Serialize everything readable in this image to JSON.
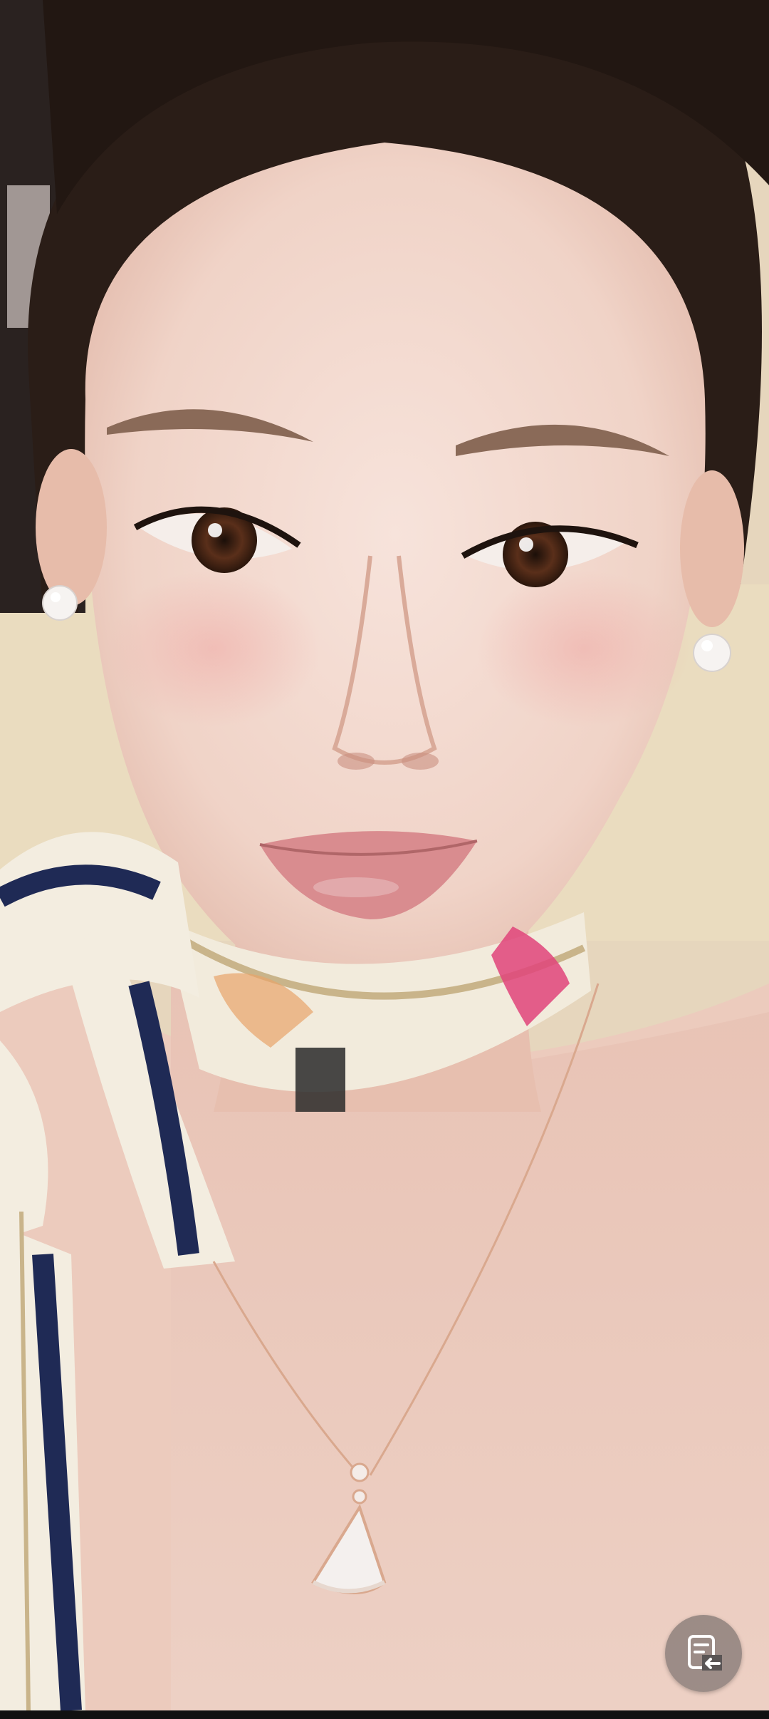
{
  "screen": {
    "type": "fullscreen-video",
    "subject": "selfie-portrait"
  },
  "floating_button": {
    "icon": "document-back-icon",
    "tint": "#ffffff",
    "background": "#5a5555"
  },
  "colors": {
    "skin": "#f0d4c8",
    "hair": "#2a1d17",
    "scarf_cream": "#f2ebdc",
    "scarf_navy": "#1f2a55",
    "background_wall": "#e9dcc2"
  }
}
